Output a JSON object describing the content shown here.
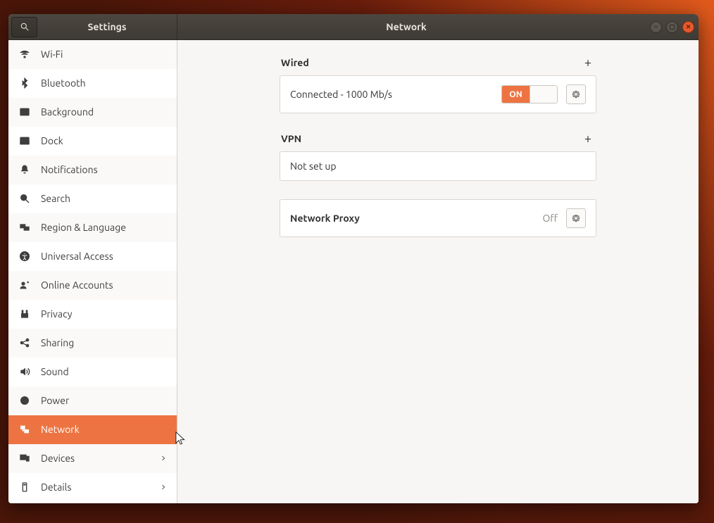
{
  "header": {
    "settings_title": "Settings",
    "page_title": "Network"
  },
  "sidebar": {
    "items": [
      {
        "label": "Wi-Fi"
      },
      {
        "label": "Bluetooth"
      },
      {
        "label": "Background"
      },
      {
        "label": "Dock"
      },
      {
        "label": "Notifications"
      },
      {
        "label": "Search"
      },
      {
        "label": "Region & Language"
      },
      {
        "label": "Universal Access"
      },
      {
        "label": "Online Accounts"
      },
      {
        "label": "Privacy"
      },
      {
        "label": "Sharing"
      },
      {
        "label": "Sound"
      },
      {
        "label": "Power"
      },
      {
        "label": "Network"
      },
      {
        "label": "Devices"
      },
      {
        "label": "Details"
      }
    ]
  },
  "sections": {
    "wired": {
      "title": "Wired",
      "status": "Connected - 1000 Mb/s",
      "toggle_label": "ON"
    },
    "vpn": {
      "title": "VPN",
      "status": "Not set up"
    },
    "proxy": {
      "title": "Network Proxy",
      "status": "Off"
    }
  },
  "colors": {
    "accent": "#ed7442"
  }
}
